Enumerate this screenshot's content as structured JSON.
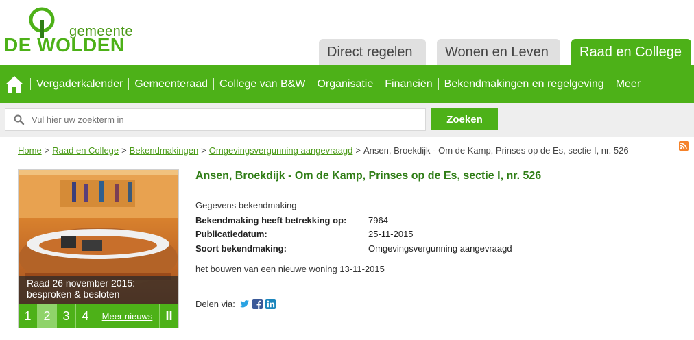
{
  "logo": {
    "small": "gemeente",
    "big": "DE WOLDEN"
  },
  "tabs": [
    {
      "label": "Direct regelen"
    },
    {
      "label": "Wonen en Leven"
    },
    {
      "label": "Raad en College"
    }
  ],
  "nav": {
    "items": [
      "Vergaderkalender",
      "Gemeenteraad",
      "College van B&W",
      "Organisatie",
      "Financiën",
      "Bekendmakingen en regelgeving",
      "Meer"
    ]
  },
  "search": {
    "placeholder": "Vul hier uw zoekterm in",
    "button": "Zoeken"
  },
  "breadcrumb": {
    "links": [
      "Home",
      "Raad en College",
      "Bekendmakingen",
      "Omgevingsvergunning aangevraagd"
    ],
    "current": "Ansen, Broekdijk - Om de Kamp, Prinses op de Es, sectie I, nr. 526"
  },
  "slider": {
    "caption_line1": "Raad 26 november 2015:",
    "caption_line2": "besproken & besloten",
    "pages": [
      "1",
      "2",
      "3",
      "4"
    ],
    "more": "Meer nieuws",
    "pause": "II"
  },
  "article": {
    "title": "Ansen, Broekdijk - Om de Kamp, Prinses op de Es, sectie I, nr. 526",
    "detail_head": "Gegevens bekendmaking",
    "rows": [
      {
        "label": "Bekendmaking heeft betrekking op:",
        "value": "7964"
      },
      {
        "label": "Publicatiedatum:",
        "value": "25-11-2015"
      },
      {
        "label": "Soort bekendmaking:",
        "value": "Omgevingsvergunning aangevraagd"
      }
    ],
    "description": "het bouwen van een nieuwe woning 13-11-2015",
    "share_label": "Delen via:"
  },
  "colors": {
    "green": "#4db118",
    "dark_green": "#2f7d16",
    "tab_grey": "#e0e0e0"
  }
}
